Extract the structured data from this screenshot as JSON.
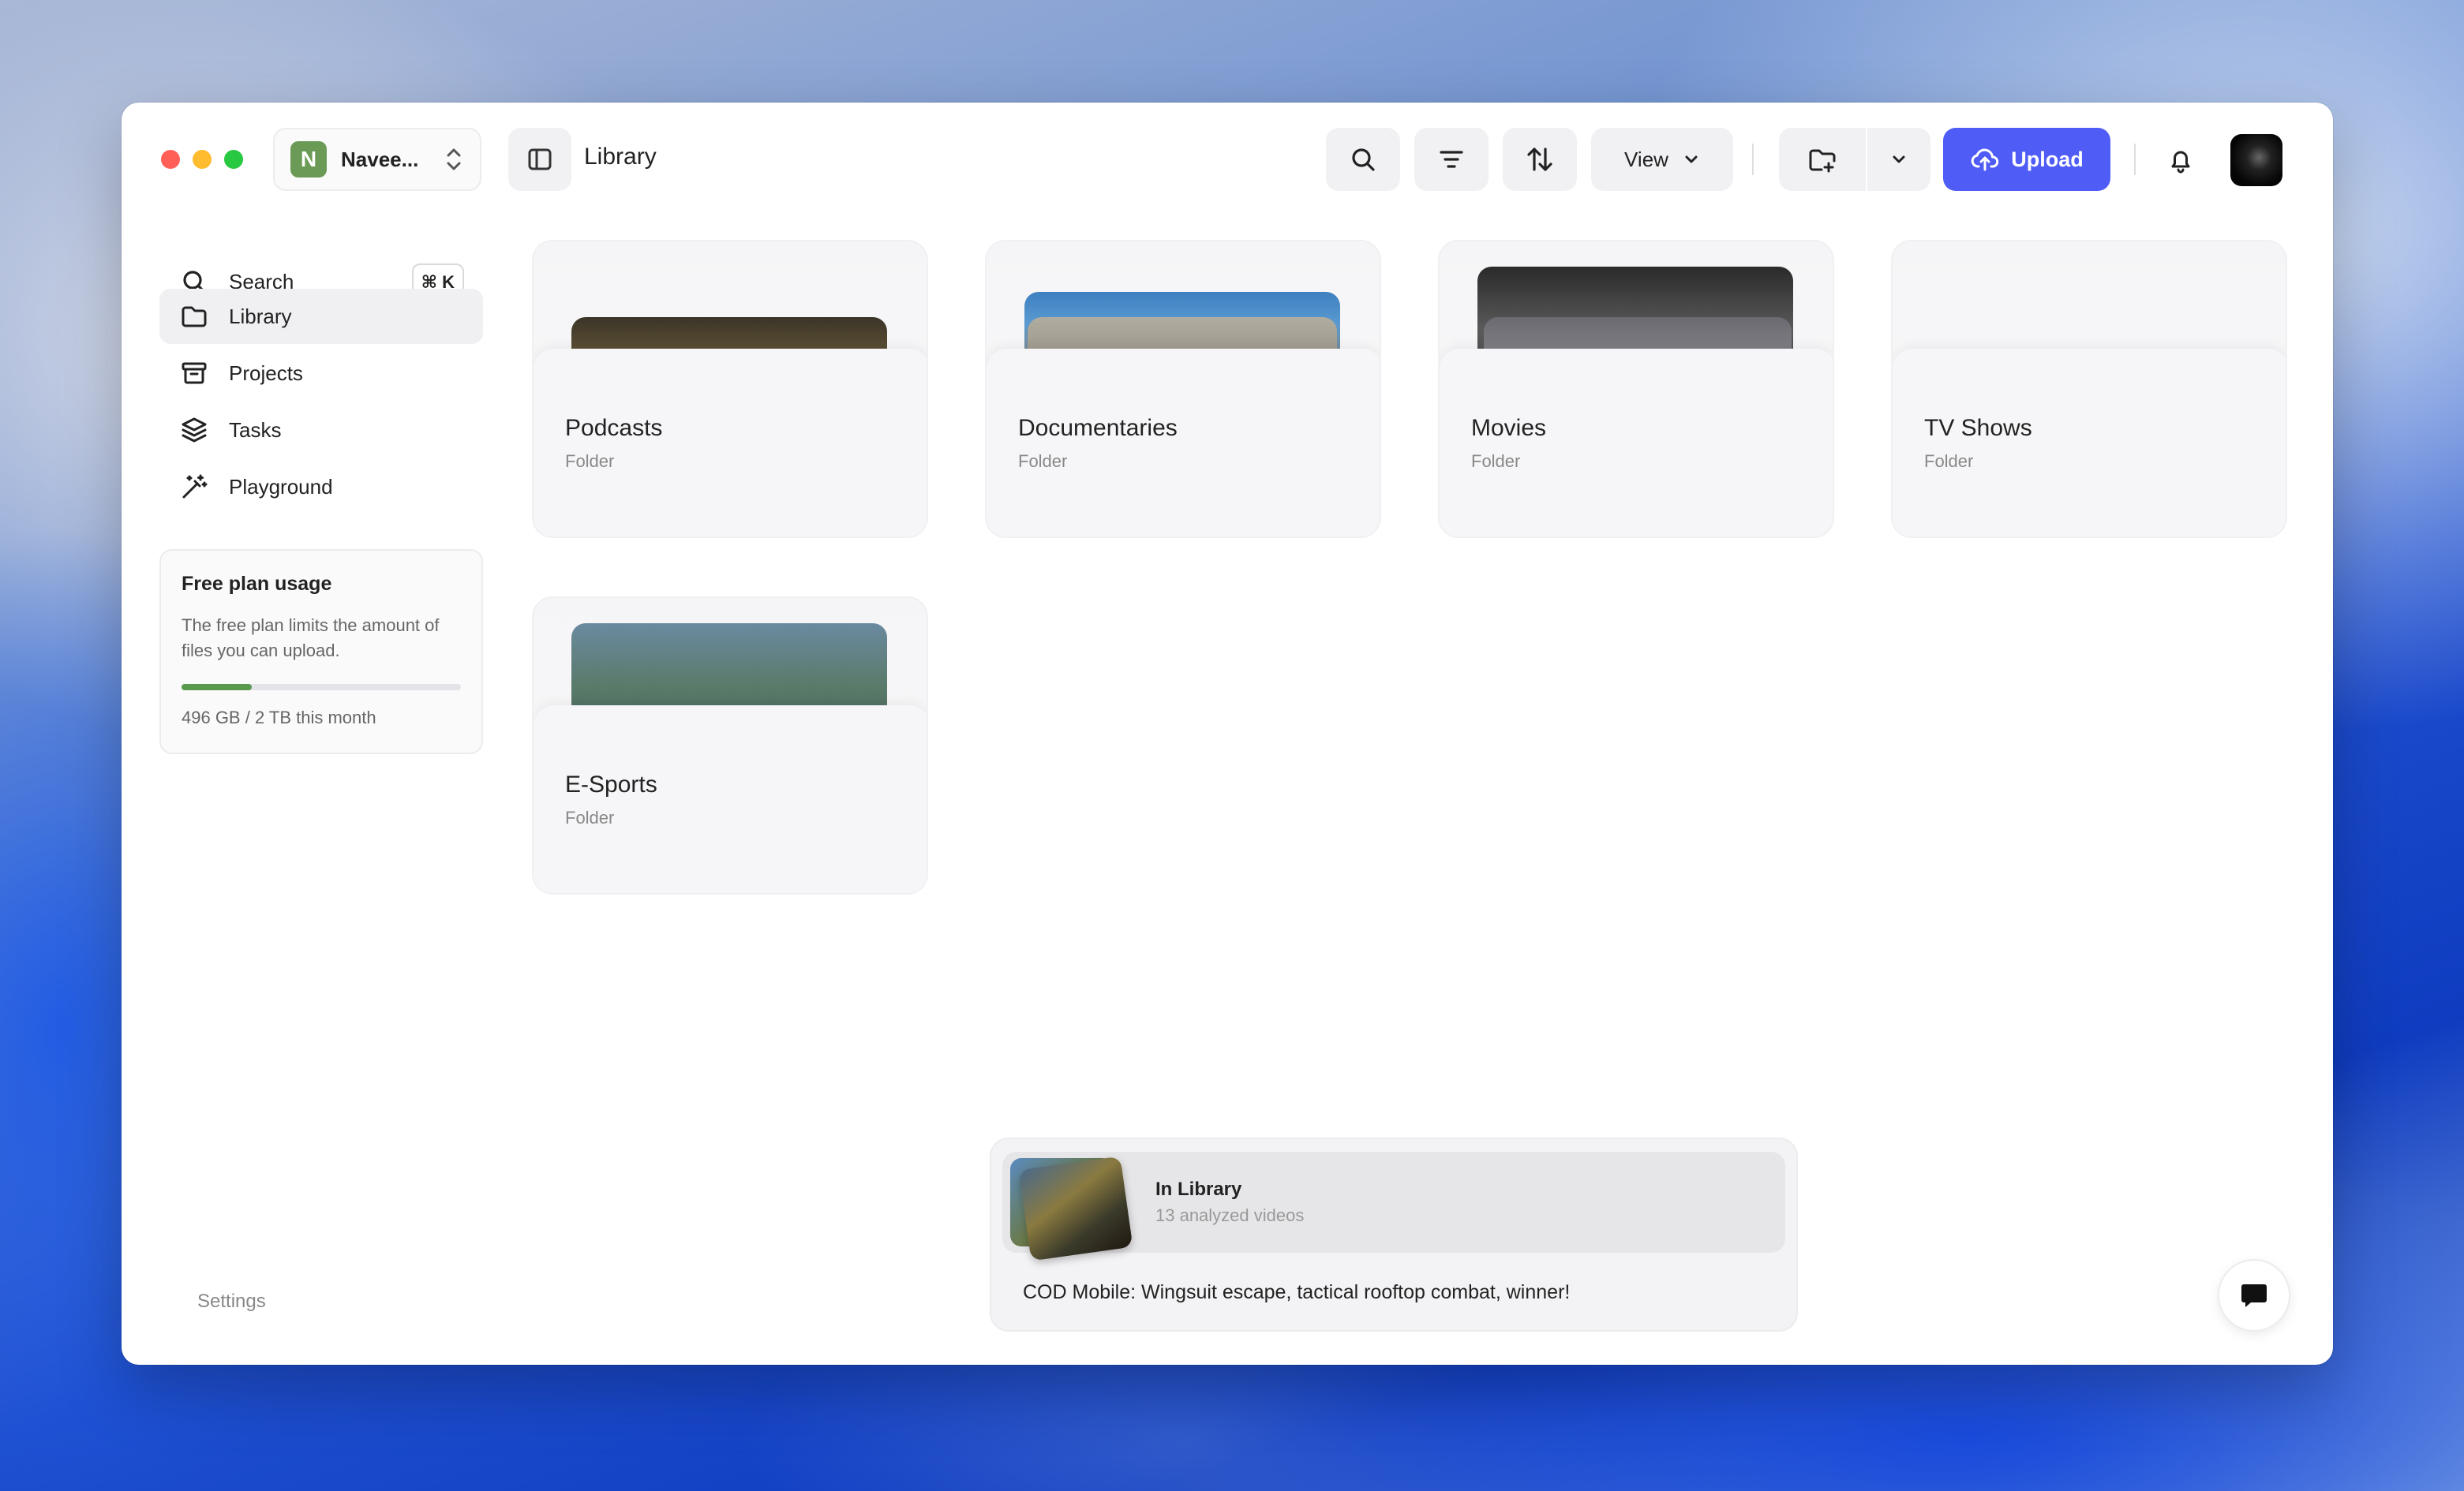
{
  "workspace": {
    "initial": "N",
    "name": "Navee..."
  },
  "header": {
    "title": "Library",
    "view_label": "View",
    "upload_label": "Upload"
  },
  "sidebar": {
    "search": {
      "label": "Search",
      "shortcut": "⌘ K"
    },
    "items": [
      {
        "label": "Library",
        "icon": "folder-icon",
        "active": true
      },
      {
        "label": "Projects",
        "icon": "archive-icon"
      },
      {
        "label": "Tasks",
        "icon": "layers-icon"
      },
      {
        "label": "Playground",
        "icon": "magic-wand-icon"
      }
    ],
    "usage": {
      "title": "Free plan usage",
      "description": "The free plan limits the amount of files you can upload.",
      "progress_fraction": 0.25,
      "text": "496 GB / 2 TB this month"
    },
    "settings_label": "Settings"
  },
  "folders": [
    {
      "name": "Podcasts",
      "type": "Folder"
    },
    {
      "name": "Documentaries",
      "type": "Folder"
    },
    {
      "name": "Movies",
      "type": "Folder"
    },
    {
      "name": "TV Shows",
      "type": "Folder"
    },
    {
      "name": "E-Sports",
      "type": "Folder"
    }
  ],
  "recent": {
    "label": "In Library",
    "count": "13 analyzed videos",
    "title": "COD Mobile: Wingsuit escape, tactical rooftop combat, winner!"
  },
  "colors": {
    "accent": "#4f5cf5",
    "usage_bar": "#5a9a4e",
    "workspace_avatar": "#6a9a55"
  }
}
